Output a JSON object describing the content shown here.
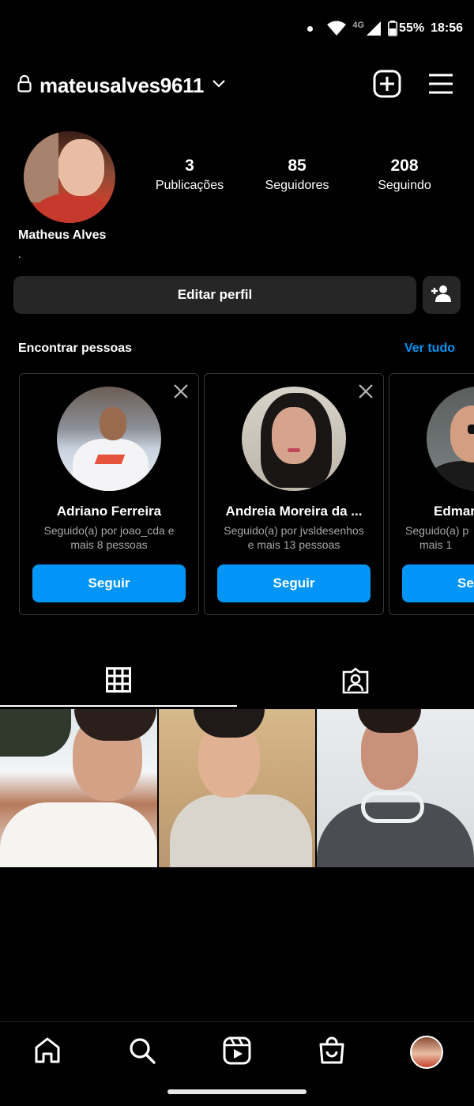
{
  "status_bar": {
    "network": "4G",
    "battery": "55%",
    "time": "18:56"
  },
  "header": {
    "username": "mateusalves9611",
    "icons": [
      "lock-icon",
      "chevron-down-icon",
      "new-post-icon",
      "menu-icon"
    ]
  },
  "profile": {
    "stats": [
      {
        "count": "3",
        "label": "Publicações"
      },
      {
        "count": "85",
        "label": "Seguidores"
      },
      {
        "count": "208",
        "label": "Seguindo"
      }
    ],
    "full_name": "Matheus Alves",
    "bio": ".",
    "edit_label": "Editar perfil"
  },
  "discover": {
    "title": "Encontrar pessoas",
    "see_all": "Ver tudo",
    "cards": [
      {
        "name": "Adriano Ferreira",
        "sub1": "Seguido(a) por joao_cda e",
        "sub2": "mais 8 pessoas",
        "button": "Seguir"
      },
      {
        "name": "Andreia Moreira da ...",
        "sub1": "Seguido(a) por jvsldesenhos",
        "sub2": "e mais 13 pessoas",
        "button": "Seguir"
      },
      {
        "name": "Edmar",
        "sub1": "Seguido(a) p",
        "sub2": "mais 1",
        "button": "Se"
      }
    ]
  },
  "tabs": [
    "grid-icon",
    "tagged-icon"
  ],
  "bottom_nav": [
    "home-icon",
    "search-icon",
    "reels-icon",
    "shop-icon",
    "profile-avatar"
  ],
  "colors": {
    "accent": "#0095f6",
    "background": "#000000",
    "surface": "#262626",
    "muted_text": "#a8a8a8"
  }
}
